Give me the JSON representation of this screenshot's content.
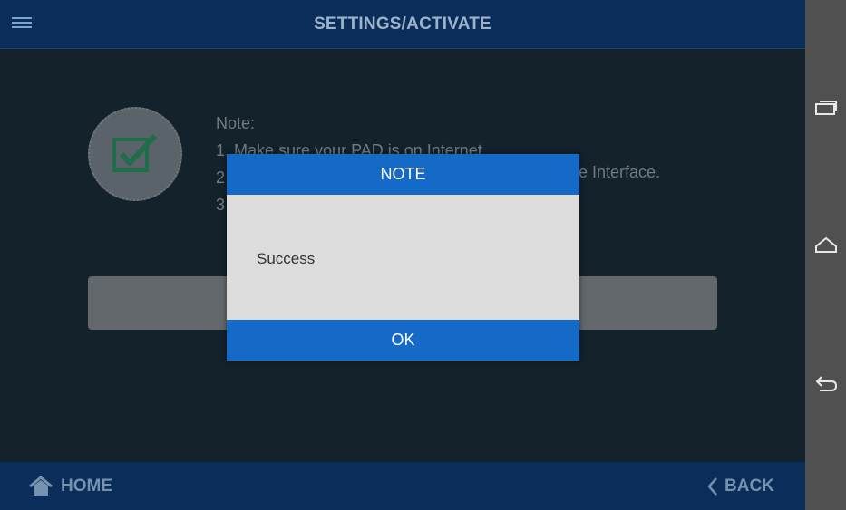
{
  "header": {
    "title": "SETTINGS/ACTIVATE",
    "menu_icon": "menu-icon"
  },
  "background": {
    "note_lines": [
      "Note:",
      "1. Make sure your PAD is on Internet.",
      "2",
      "3"
    ],
    "note_tail": "e Interface.",
    "badge_icon": "checkbox-check-icon"
  },
  "dialog": {
    "title": "NOTE",
    "message": "Success",
    "ok_label": "OK"
  },
  "footer": {
    "home_label": "HOME",
    "home_icon": "home-icon",
    "back_label": "BACK",
    "back_icon": "chevron-left-icon"
  },
  "navbar": {
    "icons": [
      "recent-apps-icon",
      "home-nav-icon",
      "back-nav-icon"
    ]
  },
  "colors": {
    "header_bg": "#0a2d5a",
    "dialog_accent": "#1569c7",
    "content_bg": "#13222b",
    "navbar_bg": "#505050"
  }
}
